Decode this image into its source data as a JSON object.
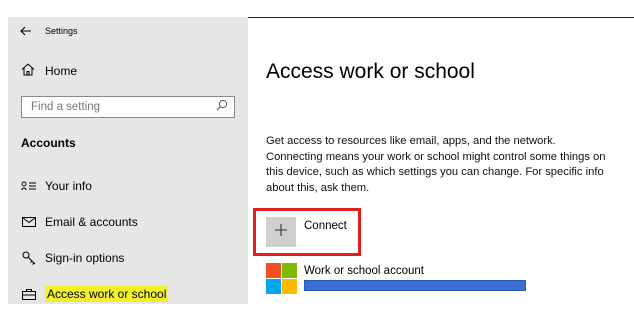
{
  "window": {
    "title": "Settings"
  },
  "sidebar": {
    "home_label": "Home",
    "search_placeholder": "Find a setting",
    "section_title": "Accounts",
    "items": [
      {
        "label": "Your info",
        "icon": "person-lines-icon",
        "active": false
      },
      {
        "label": "Email & accounts",
        "icon": "envelope-icon",
        "active": false
      },
      {
        "label": "Sign-in options",
        "icon": "key-icon",
        "active": false
      },
      {
        "label": "Access work or school",
        "icon": "briefcase-icon",
        "active": true
      }
    ]
  },
  "main": {
    "title": "Access work or school",
    "description": "Get access to resources like email, apps, and the network. Connecting means your work or school might control some things on this device, such as which settings you can change. For specific info about this, ask them.",
    "connect_label": "Connect",
    "account_label": "Work or school account"
  },
  "colors": {
    "sidebar_bg": "#e6e6e6",
    "highlight": "#f4f02a",
    "callout_border": "#e0201c",
    "redaction_bar": "#3c6fd6",
    "ms_red": "#f25022",
    "ms_green": "#7fba00",
    "ms_blue": "#00a4ef",
    "ms_yellow": "#ffb900"
  }
}
